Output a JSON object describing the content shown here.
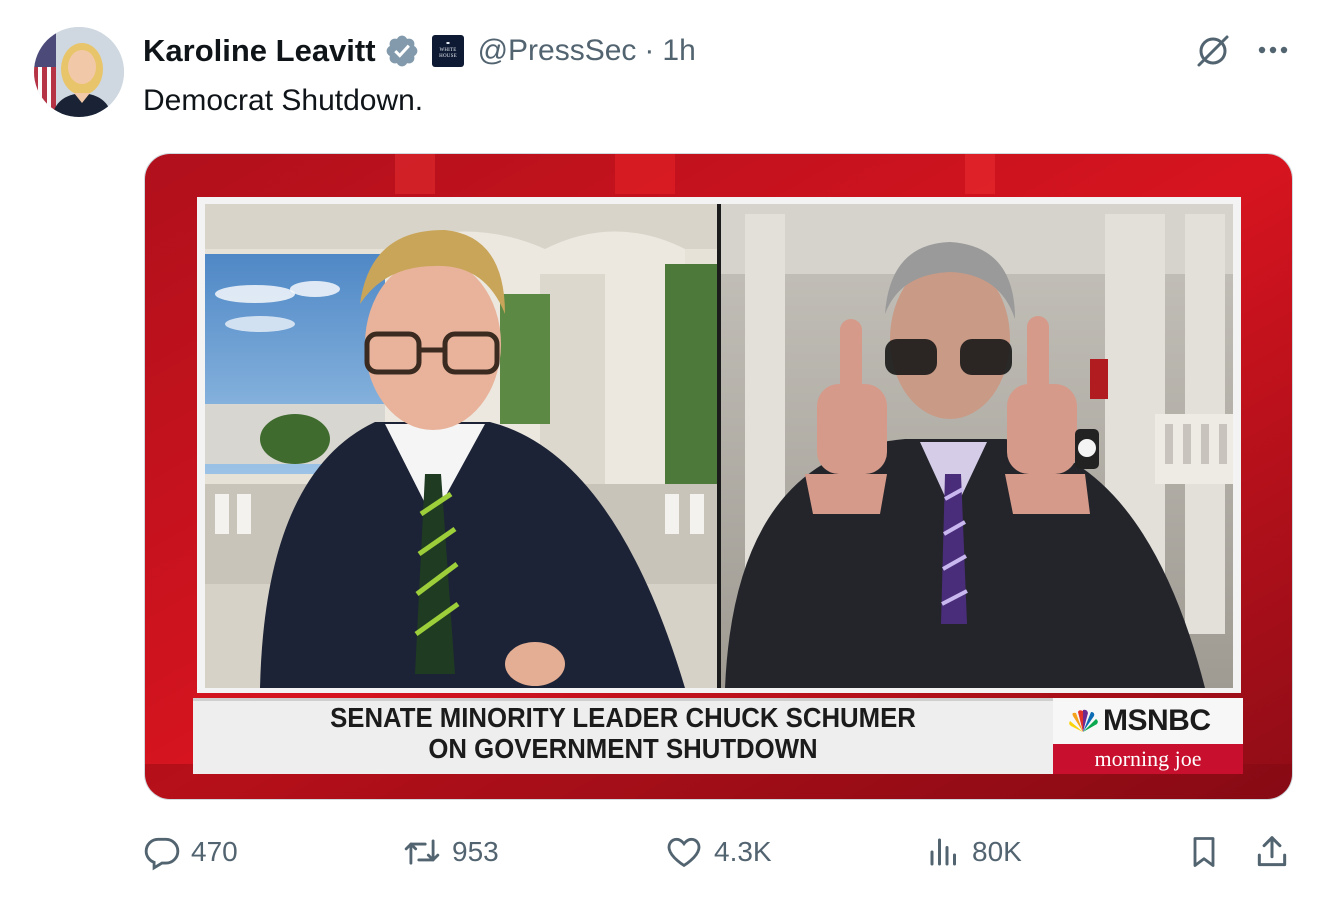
{
  "tweet": {
    "author_name": "Karoline Leavitt",
    "handle": "@PressSec",
    "separator": "·",
    "time": "1h",
    "badge_text": "THE WHITE HOUSE",
    "text": "Democrat Shutdown.",
    "icons": {
      "verified": "verified-check-icon",
      "affiliation": "white-house-badge-icon",
      "grok": "grok-icon",
      "more": "more-options-icon"
    }
  },
  "media": {
    "chyron_line1": "SENATE MINORITY LEADER CHUCK SCHUMER",
    "chyron_line2": "ON GOVERNMENT SHUTDOWN",
    "network": "MSNBC",
    "show": "morning joe"
  },
  "actions": {
    "replies": "470",
    "reposts": "953",
    "likes": "4.3K",
    "views": "80K",
    "icons": [
      "reply-icon",
      "repost-icon",
      "like-icon",
      "views-icon",
      "bookmark-icon",
      "share-icon"
    ]
  },
  "colors": {
    "verified": "#829aab",
    "text_primary": "#0f1419",
    "text_secondary": "#536471",
    "msnbc_red": "#c8102e"
  }
}
